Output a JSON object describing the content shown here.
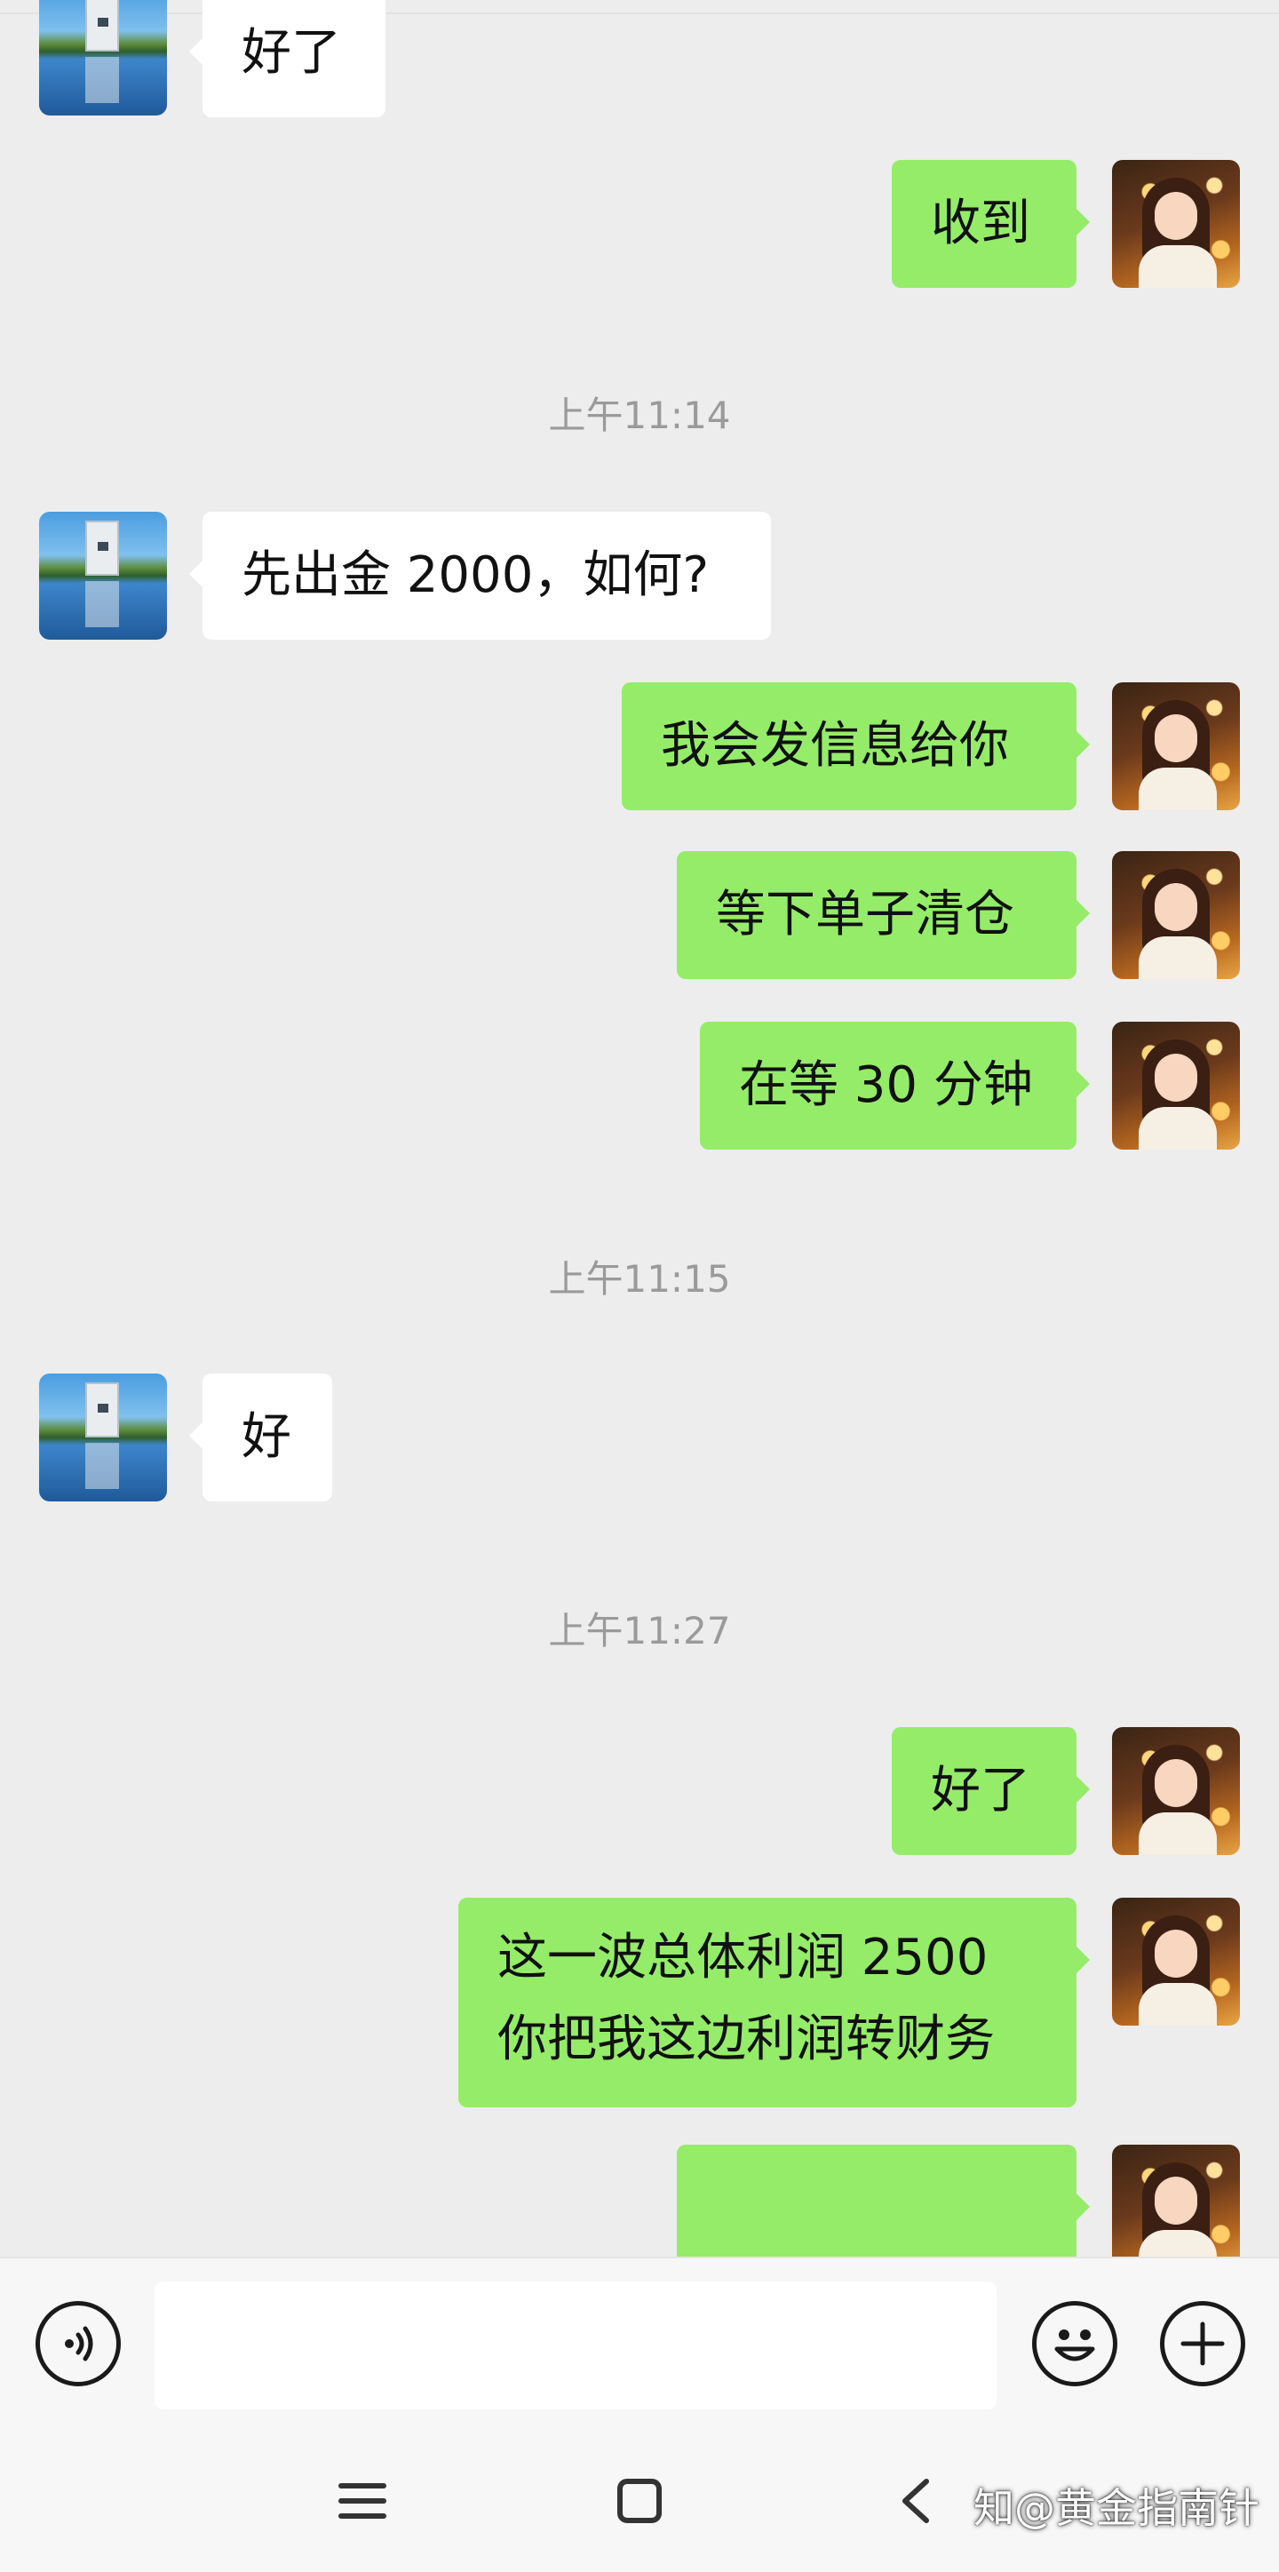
{
  "messages": [
    {
      "side": "left",
      "text": "好了"
    },
    {
      "side": "right",
      "text": "收到"
    },
    {
      "side": "time",
      "text": "上午11:14"
    },
    {
      "side": "left",
      "text": "先出金 2000，如何?"
    },
    {
      "side": "right",
      "text": "我会发信息给你"
    },
    {
      "side": "right",
      "text": "等下单子清仓"
    },
    {
      "side": "right",
      "text": "在等 30 分钟"
    },
    {
      "side": "time",
      "text": "上午11:15"
    },
    {
      "side": "left",
      "text": "好"
    },
    {
      "side": "time",
      "text": "上午11:27"
    },
    {
      "side": "right",
      "text": "好了"
    },
    {
      "side": "right",
      "lines": [
        "这一波总体利润 2500",
        "你把我这边利润转财务"
      ]
    },
    {
      "side": "right",
      "text": ""
    }
  ],
  "avatars": {
    "contact": "building-photo-avatar",
    "self": "girl-illustration-avatar"
  },
  "input_bar": {
    "voice_icon": "voice-icon",
    "emoji_icon": "emoji-icon",
    "plus_icon": "plus-icon",
    "placeholder": ""
  },
  "nav_bar": {
    "menu_icon": "menu-icon",
    "home_icon": "home-icon",
    "back_icon": "back-icon"
  },
  "watermark": "知@黄金指南针",
  "colors": {
    "background": "#ededed",
    "bubble_self": "#95ec69",
    "bubble_other": "#ffffff",
    "time_text": "#9a9a9a"
  }
}
